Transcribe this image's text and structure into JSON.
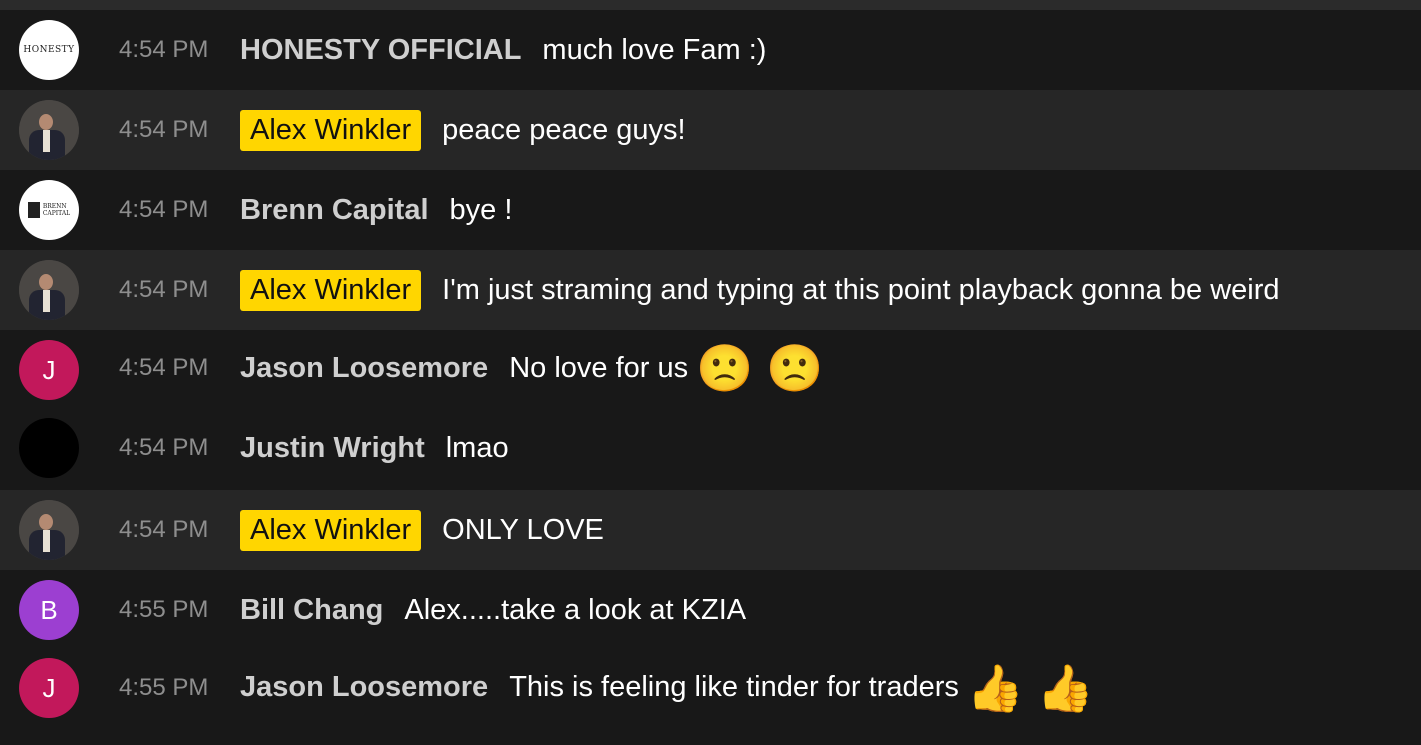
{
  "messages": [
    {
      "time": "4:54 PM",
      "author": "HONESTY OFFICIAL",
      "text": "much love Fam :)",
      "avatar": "HONESTY"
    },
    {
      "time": "4:54 PM",
      "author": "Alex Winkler",
      "text": "peace peace guys!"
    },
    {
      "time": "4:54 PM",
      "author": "Brenn Capital",
      "text": "bye !"
    },
    {
      "time": "4:54 PM",
      "author": "Alex Winkler",
      "text": "I'm just straming and typing at this point playback gonna be weird"
    },
    {
      "time": "4:54 PM",
      "author": "Jason Loosemore",
      "text": "No love for us",
      "avatar": "J",
      "emoji": "🙁 🙁"
    },
    {
      "time": "4:54 PM",
      "author": "Justin Wright",
      "text": "lmao"
    },
    {
      "time": "4:54 PM",
      "author": "Alex Winkler",
      "text": "ONLY LOVE"
    },
    {
      "time": "4:55 PM",
      "author": "Bill Chang",
      "text": "Alex.....take a look at KZIA",
      "avatar": "B"
    },
    {
      "time": "4:55 PM",
      "author": "Jason Loosemore",
      "text": "This is feeling like tinder for traders",
      "avatar": "J",
      "emoji": "👍 👍"
    }
  ],
  "colors": {
    "owner_badge": "#ffd600",
    "avatar_j": "#c2185b",
    "avatar_b": "#9c3fd1",
    "background": "#181818",
    "highlight_row": "#262626"
  }
}
